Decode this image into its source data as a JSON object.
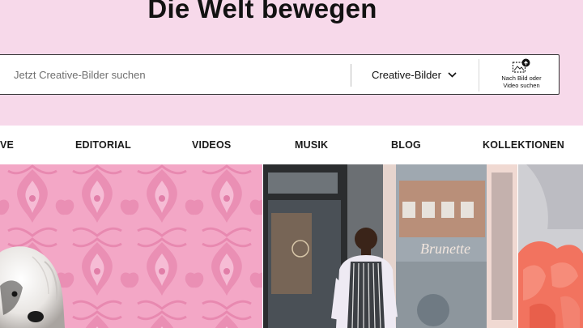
{
  "hero": {
    "title": "Die Welt bewegen",
    "background": "#f7d9ea"
  },
  "search": {
    "placeholder": "Jetzt Creative-Bilder suchen",
    "value": "",
    "type_label": "Creative-Bilder",
    "visual_search_label_line1": "Nach Bild oder",
    "visual_search_label_line2": "Video suchen"
  },
  "nav": {
    "tabs": [
      {
        "label": "VE",
        "active": true
      },
      {
        "label": "EDITORIAL"
      },
      {
        "label": "VIDEOS"
      },
      {
        "label": "MUSIK"
      },
      {
        "label": "BLOG"
      },
      {
        "label": "KOLLEKTIONEN"
      }
    ],
    "accent": "#6a1fc4"
  },
  "photos": {
    "p2_sign": "Brunette"
  }
}
